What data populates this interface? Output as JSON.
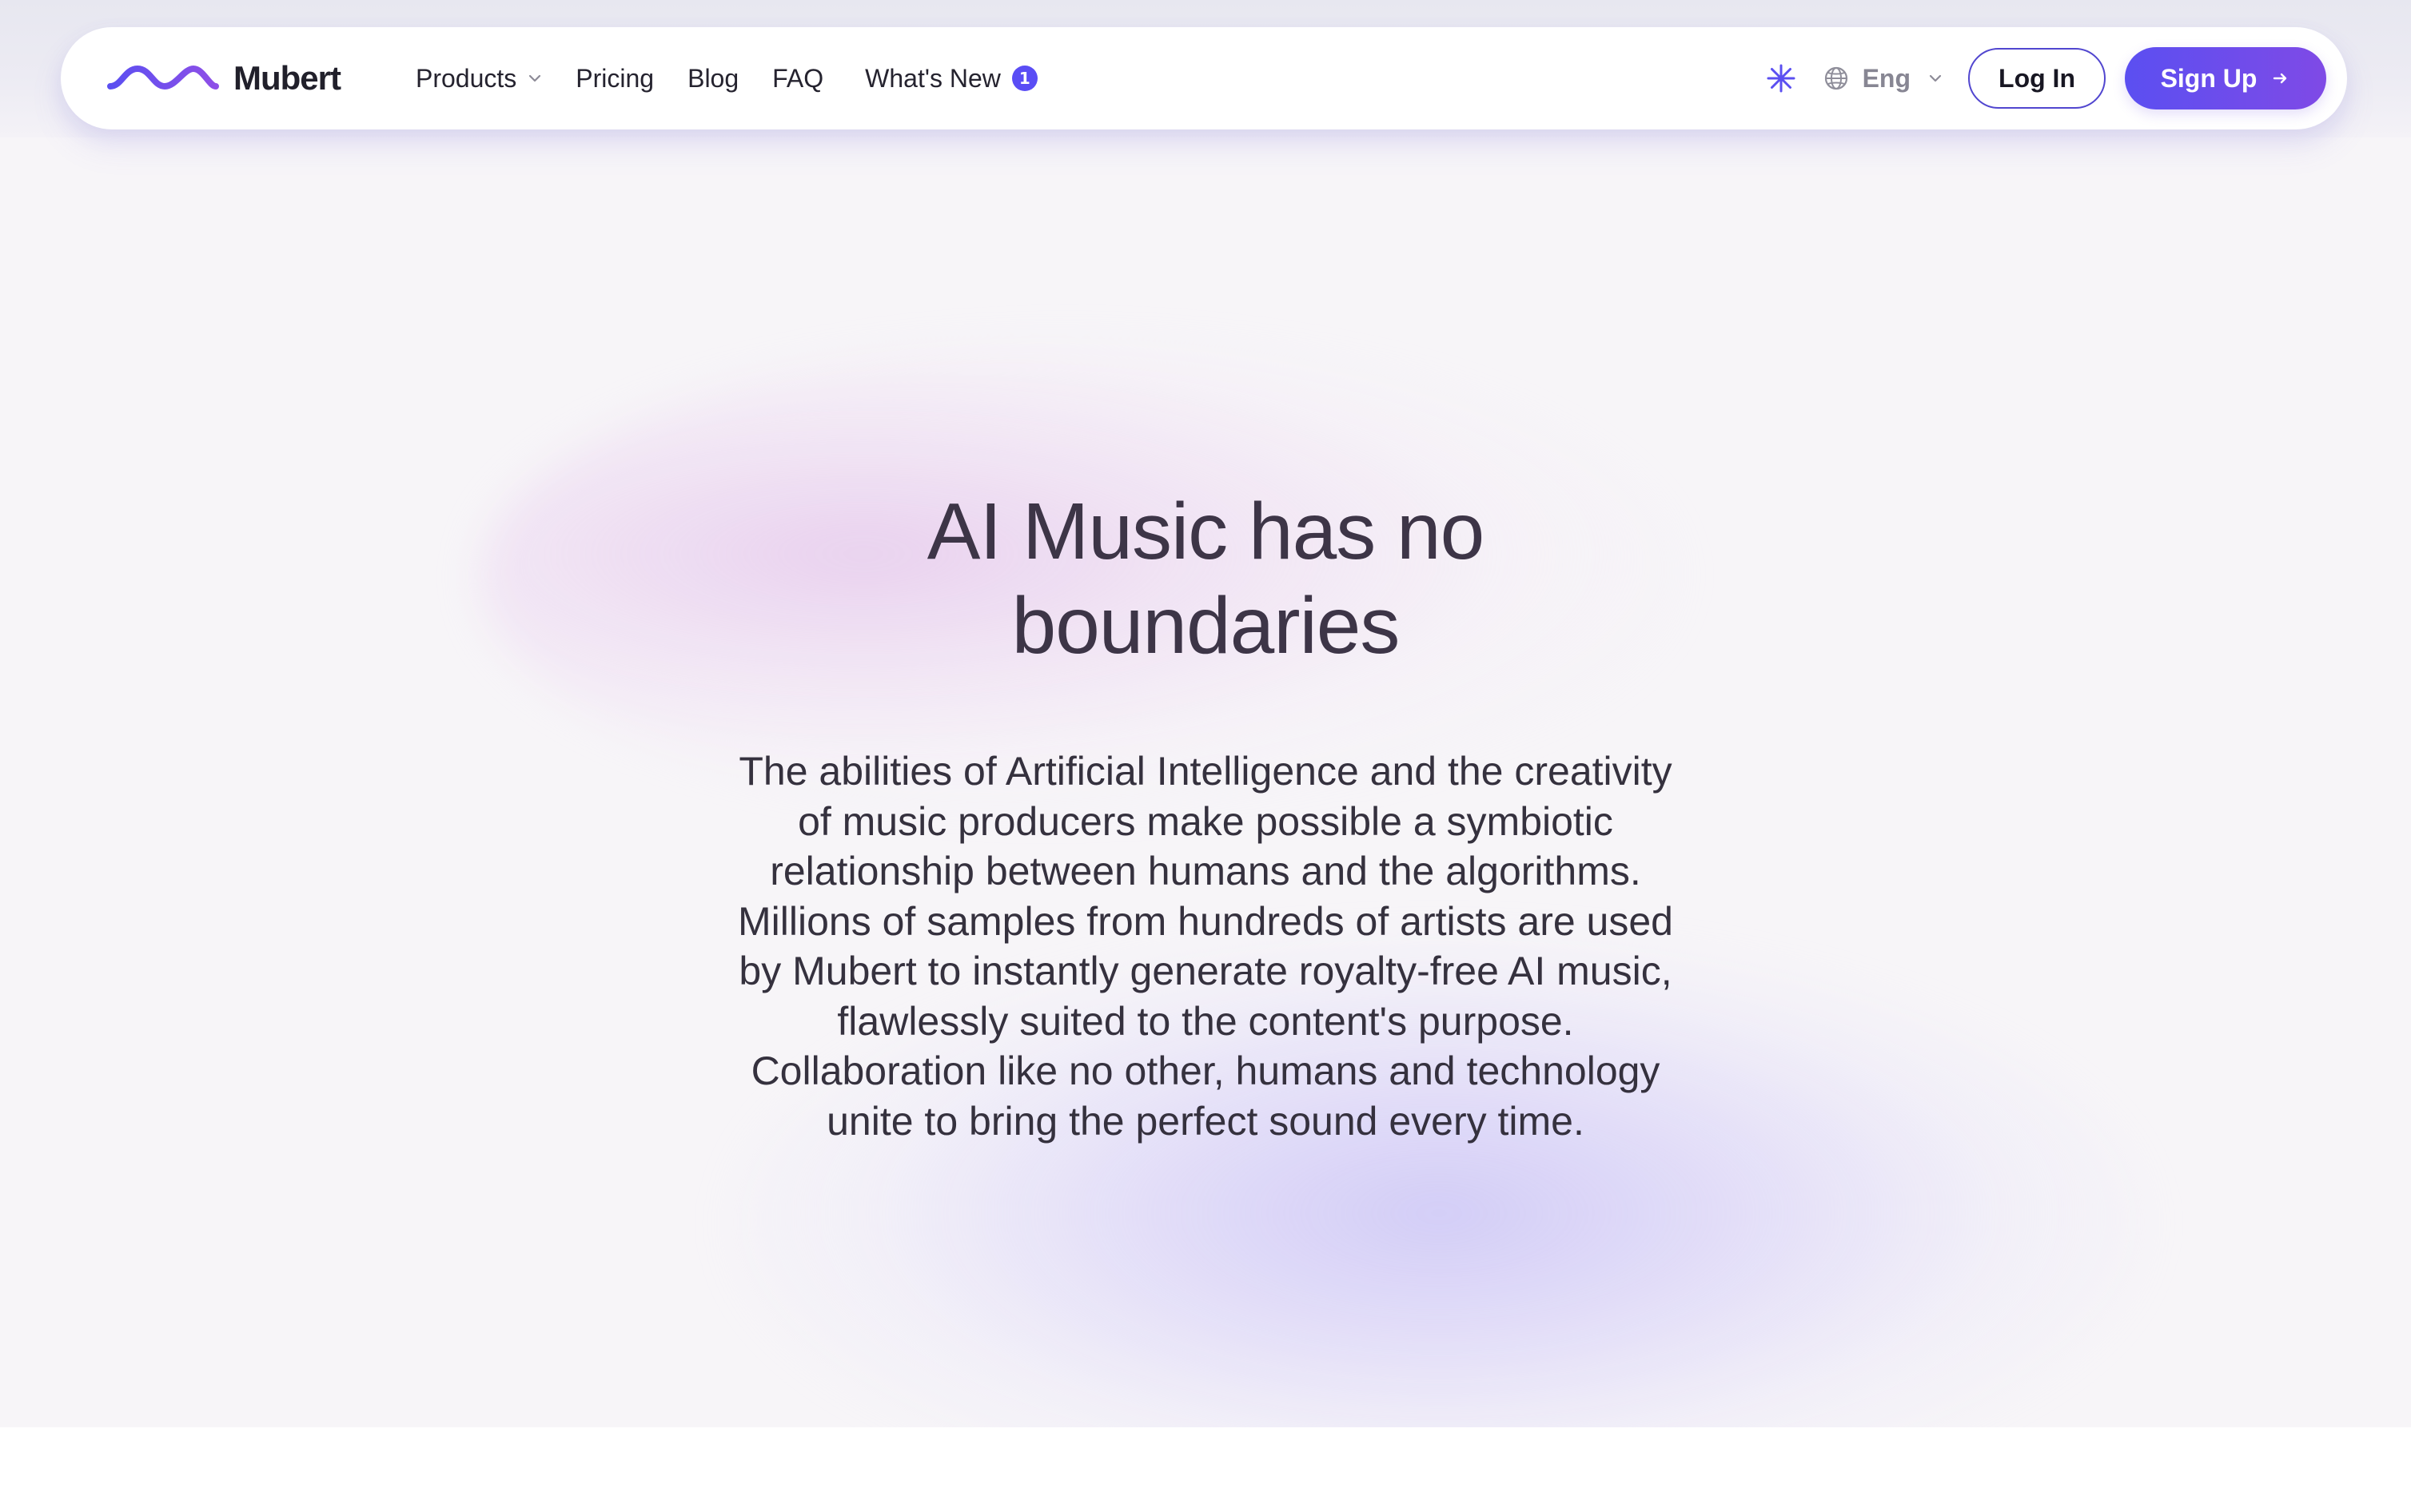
{
  "header": {
    "brand": {
      "name": "Mubert",
      "logo_icon": "wave-logo-icon"
    },
    "nav": [
      {
        "label": "Products",
        "icon": "chevron-down-icon"
      },
      {
        "label": "Pricing"
      },
      {
        "label": "Blog"
      },
      {
        "label": "FAQ"
      },
      {
        "label": "What's New",
        "badge": "1"
      }
    ],
    "actions": {
      "theme_icon": "asterisk-icon",
      "language": {
        "value": "Eng",
        "icon": "globe-icon",
        "dropdown_icon": "chevron-down-icon"
      },
      "login_label": "Log In",
      "signup_label": "Sign Up",
      "signup_icon": "arrow-right-icon"
    }
  },
  "hero": {
    "title_lines": [
      "AI Music has no",
      "boundaries"
    ],
    "body_lines": [
      "The abilities of Artificial Intelligence and the creativity",
      "of music producers make possible a symbiotic",
      "relationship between humans and the algorithms.",
      "Millions of samples from hundreds of artists are used",
      "by Mubert to instantly generate royalty-free AI music,",
      "flawlessly suited to the content's purpose.",
      "Collaboration like no other, humans and technology",
      "unite to bring the perfect sound every time."
    ]
  },
  "colors": {
    "accent": "#5a4df5",
    "accent_gradient_end": "#7f4ae6",
    "title_text": "#3d3547",
    "body_text": "#35313e",
    "nav_text": "#25232f",
    "muted_text": "#878693",
    "glow_pink": "#e5c7ec",
    "glow_violet": "#cfc9f6"
  }
}
